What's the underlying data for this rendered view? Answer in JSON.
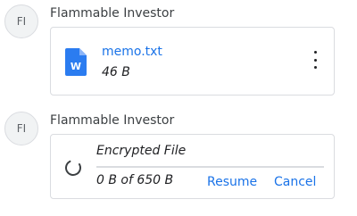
{
  "messages": [
    {
      "avatar_initials": "FI",
      "sender": "Flammable Investor",
      "file": {
        "name": "memo.txt",
        "size": "46 B",
        "icon": "word-document-icon",
        "icon_color": "#2b7cf0",
        "icon_letter": "W"
      }
    },
    {
      "avatar_initials": "FI",
      "sender": "Flammable Investor",
      "transfer": {
        "name": "Encrypted File",
        "progress_text": "0 B of 650 B",
        "progress_fraction": 0,
        "resume_label": "Resume",
        "cancel_label": "Cancel",
        "status_icon": "loading-spinner-icon"
      }
    }
  ],
  "colors": {
    "accent": "#1a73e8",
    "border": "#dadce0"
  }
}
